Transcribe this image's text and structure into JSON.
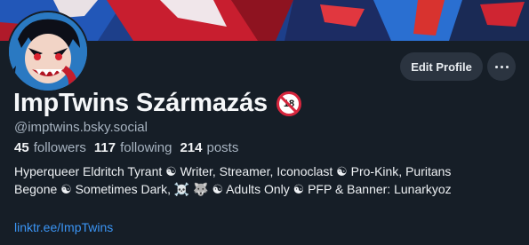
{
  "profile": {
    "display_name": "ImpTwins Származás",
    "adult_badge": "18",
    "handle": "@imptwins.bsky.social",
    "followers_count": "45",
    "followers_label": "followers",
    "following_count": "117",
    "following_label": "following",
    "posts_count": "214",
    "posts_label": "posts",
    "bio_line1": "Hyperqueer Eldritch Tyrant ☯ Writer, Streamer, Iconoclast ☯ Pro-Kink, Puritans",
    "bio_line2": "Begone ☯ Sometimes Dark, ☠️ 🐺 ☯ Adults Only ☯ PFP & Banner: Lunarkyoz",
    "link": "linktr.ee/ImpTwins"
  },
  "actions": {
    "edit_profile_label": "Edit Profile",
    "more_icon": "ellipsis-icon"
  },
  "colors": {
    "background": "#161e27",
    "button_bg": "#2b3440",
    "muted_text": "#a7b3c0",
    "link": "#3b95f5",
    "badge_red": "#d7263d"
  }
}
